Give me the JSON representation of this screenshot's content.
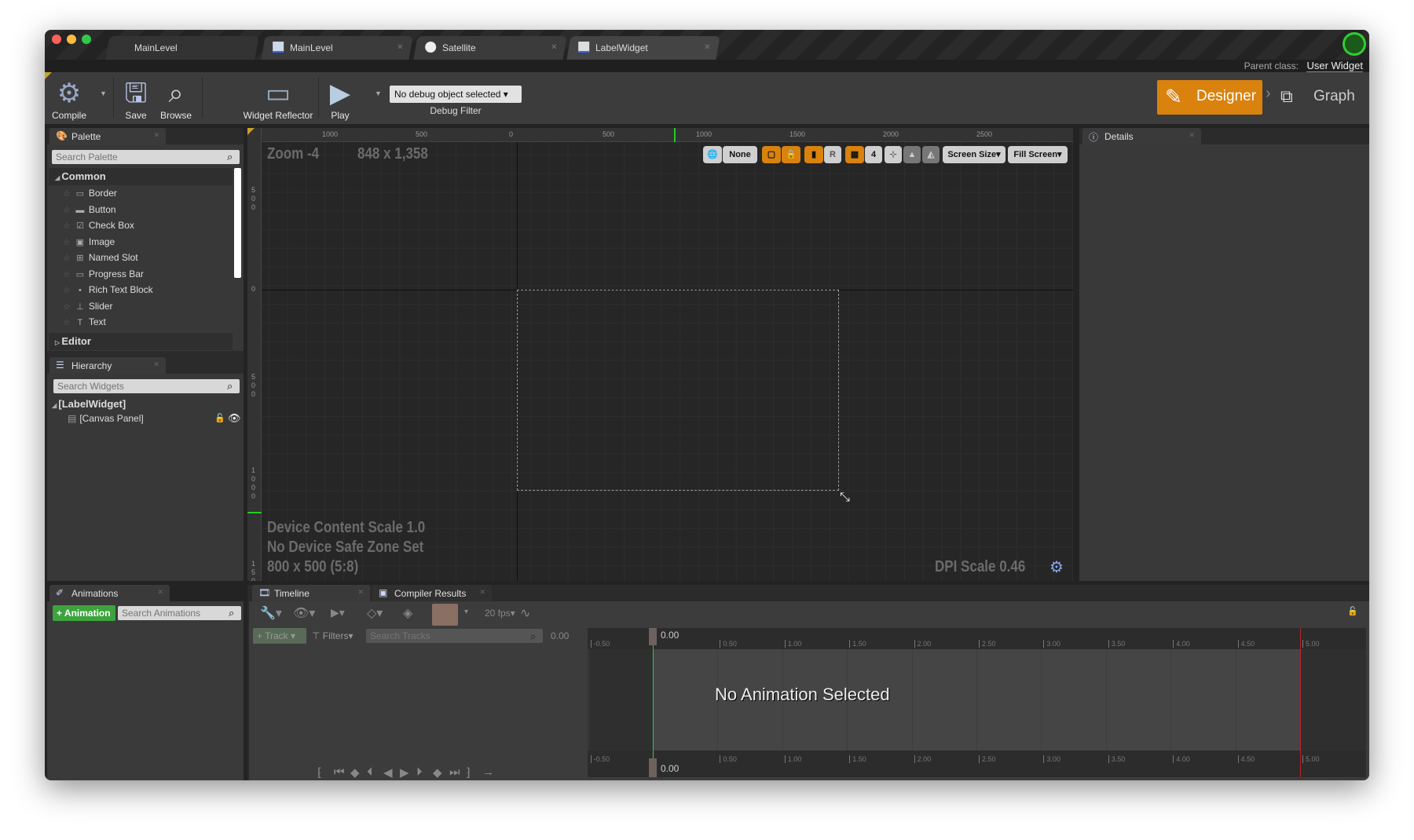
{
  "window": {
    "tabs": [
      {
        "label": "MainLevel",
        "icon": "none"
      },
      {
        "label": "MainLevel",
        "icon": "level-icon"
      },
      {
        "label": "Satellite",
        "icon": "sphere-icon"
      },
      {
        "label": "LabelWidget",
        "icon": "widget-icon"
      }
    ],
    "parent_class_label": "Parent class:",
    "parent_class_value": "User Widget"
  },
  "toolbar": {
    "compile": "Compile",
    "save": "Save",
    "browse": "Browse",
    "widget_reflector": "Widget Reflector",
    "play": "Play",
    "debug_object": "No debug object selected",
    "debug_filter": "Debug Filter",
    "designer": "Designer",
    "graph": "Graph",
    "accent": "#d9820e"
  },
  "palette": {
    "title": "Palette",
    "search_placeholder": "Search Palette",
    "category": "Common",
    "items": [
      {
        "label": "Border",
        "icon": "▭"
      },
      {
        "label": "Button",
        "icon": "▬"
      },
      {
        "label": "Check Box",
        "icon": "☑"
      },
      {
        "label": "Image",
        "icon": "▣"
      },
      {
        "label": "Named Slot",
        "icon": "⊞"
      },
      {
        "label": "Progress Bar",
        "icon": "▭"
      },
      {
        "label": "Rich Text Block",
        "icon": "•"
      },
      {
        "label": "Slider",
        "icon": "⊥"
      },
      {
        "label": "Text",
        "icon": "T"
      }
    ],
    "collapsed_category": "Editor"
  },
  "hierarchy": {
    "title": "Hierarchy",
    "search_placeholder": "Search Widgets",
    "root": "[LabelWidget]",
    "child": "[Canvas Panel]"
  },
  "designer": {
    "zoom": "Zoom -4",
    "size": "848 x 1,358",
    "ruler_h": [
      "1000",
      "500",
      "0",
      "500",
      "1000",
      "1500",
      "2000",
      "2500"
    ],
    "ruler_h_values": [
      -1000,
      -500,
      0,
      500,
      1000,
      1500,
      2000,
      2500
    ],
    "ruler_v_values": [
      -500,
      0,
      500,
      1000,
      1500
    ],
    "toolbar": {
      "none": "None",
      "r": "R",
      "grid": "4",
      "screen_size": "Screen Size",
      "fill_screen": "Fill Screen"
    },
    "device_content_scale": "Device Content Scale 1.0",
    "safe_zone": "No Device Safe Zone Set",
    "resolution": "800 x 500 (5:8)",
    "dpi_scale": "DPI Scale 0.46"
  },
  "details": {
    "title": "Details"
  },
  "animations": {
    "title": "Animations",
    "add_button": "Animation",
    "search_placeholder": "Search Animations"
  },
  "timeline": {
    "tabs": [
      "Timeline",
      "Compiler Results"
    ],
    "fps": "20 fps",
    "track_button": "Track",
    "filters": "Filters",
    "search_placeholder": "Search Tracks",
    "time_value": "0.00",
    "playhead": "0.00",
    "ticks": [
      "-0.50",
      "0.50",
      "1.00",
      "1.50",
      "2.00",
      "2.50",
      "3.00",
      "3.50",
      "4.00",
      "4.50",
      "5.00"
    ],
    "empty_message": "No Animation Selected"
  }
}
